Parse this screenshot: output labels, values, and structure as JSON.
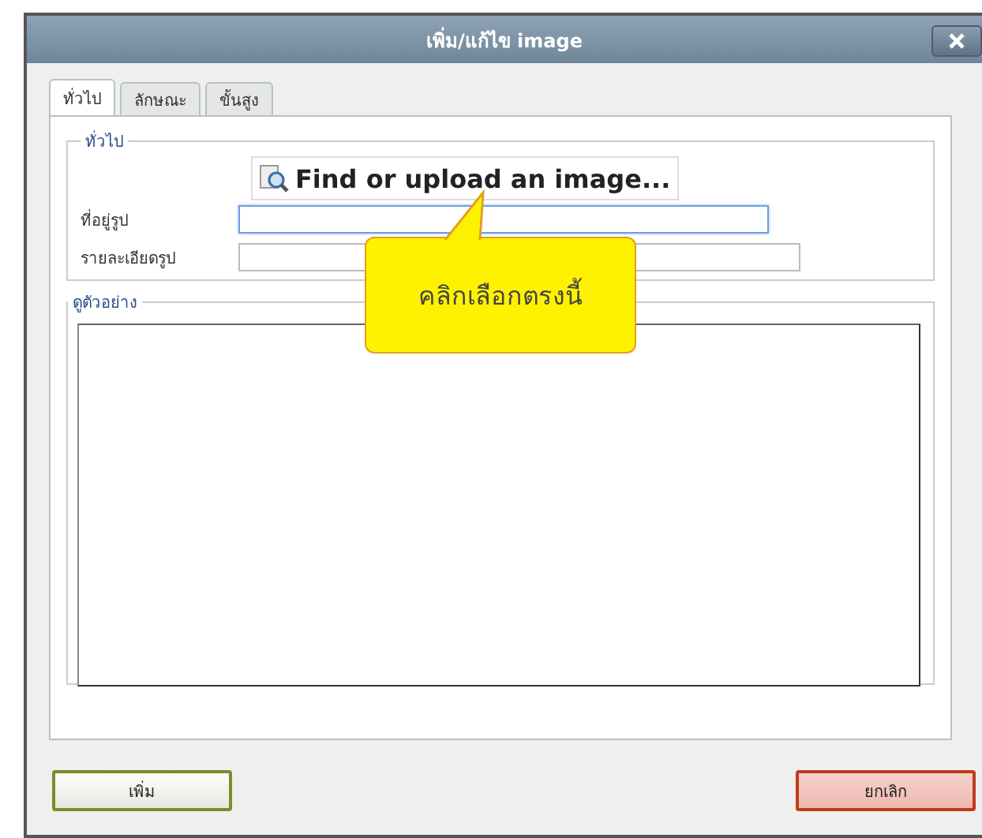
{
  "window": {
    "title": "เพิ่ม/แก้ไข image"
  },
  "tabs": [
    {
      "label": "ทั่วไป",
      "selected": true
    },
    {
      "label": "ลักษณะ",
      "selected": false
    },
    {
      "label": "ขั้นสูง",
      "selected": false
    }
  ],
  "general": {
    "legend": "ทั่วไป",
    "find_button": "Find or upload an image...",
    "fields": [
      {
        "label": "ที่อยู่รูป",
        "focused": true
      },
      {
        "label": "รายละเอียดรูป",
        "focused": false
      }
    ]
  },
  "preview": {
    "legend": "ดูตัวอย่าง"
  },
  "callout": {
    "text": "คลิกเลือกตรงนี้"
  },
  "buttons": [
    {
      "label": "เพิ่ม",
      "kind": "confirm"
    },
    {
      "label": "ยกเลิก",
      "kind": "cancel"
    }
  ]
}
